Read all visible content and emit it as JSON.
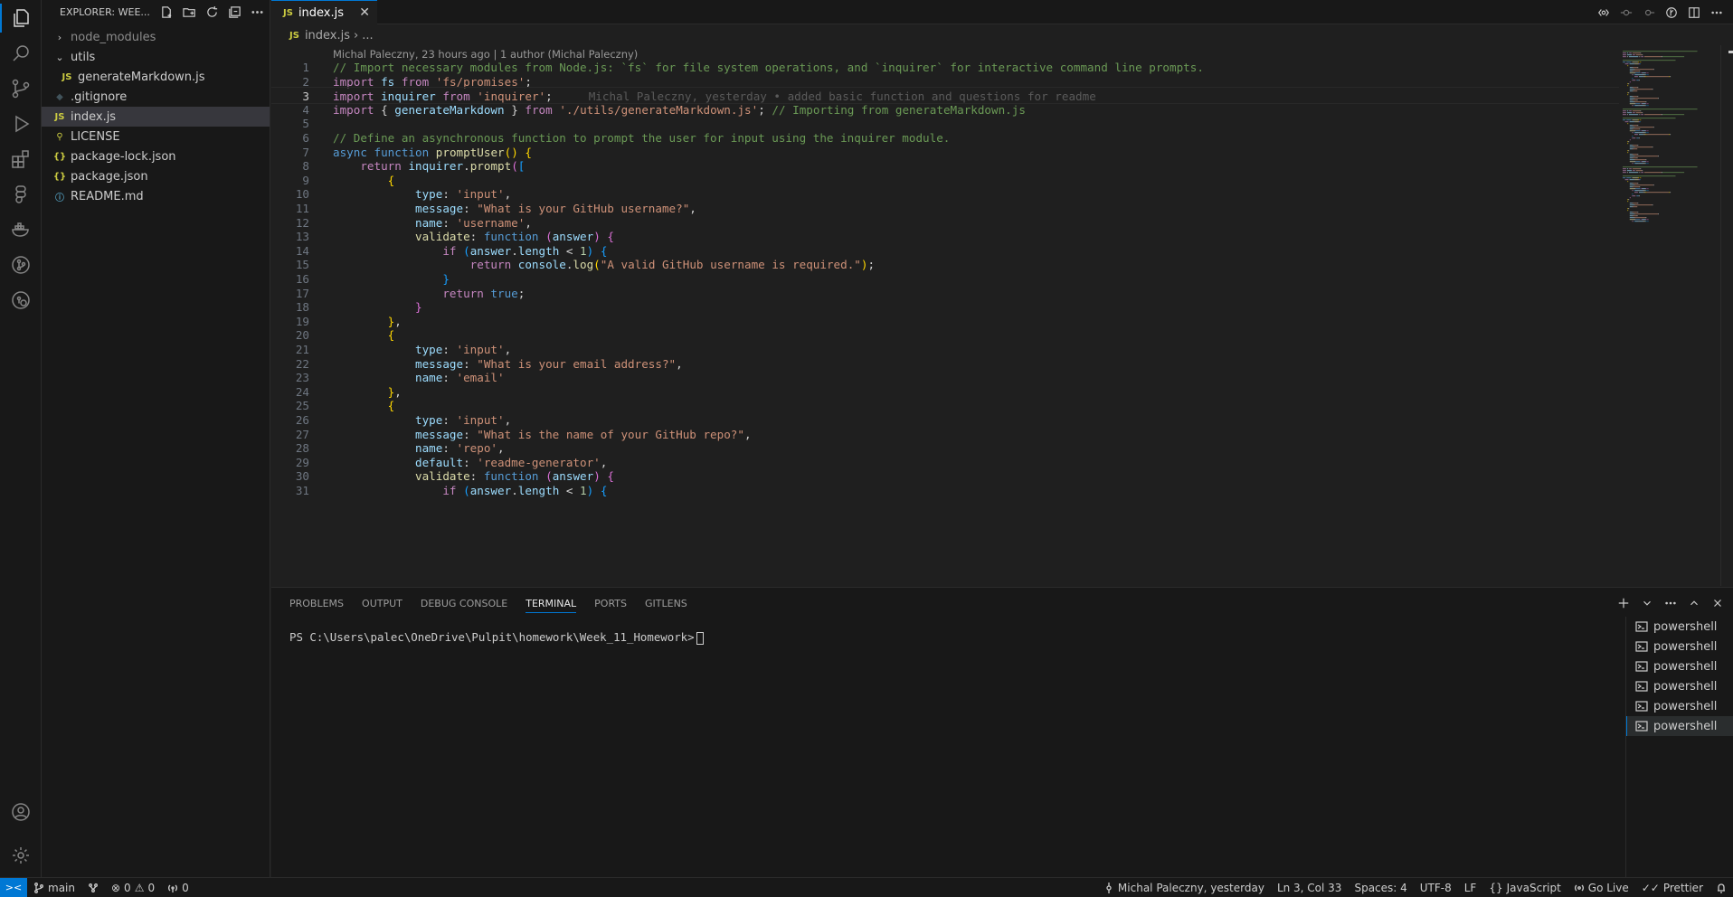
{
  "explorer": {
    "title": "EXPLORER: WEE...",
    "items": [
      {
        "label": "node_modules",
        "type": "folder-collapsed",
        "indent": 0,
        "dim": true
      },
      {
        "label": "utils",
        "type": "folder-expanded",
        "indent": 0
      },
      {
        "label": "generateMarkdown.js",
        "type": "js",
        "indent": 1
      },
      {
        "label": ".gitignore",
        "type": "gitignore",
        "indent": 0
      },
      {
        "label": "index.js",
        "type": "js",
        "indent": 0,
        "selected": true
      },
      {
        "label": "LICENSE",
        "type": "license",
        "indent": 0
      },
      {
        "label": "package-lock.json",
        "type": "json",
        "indent": 0
      },
      {
        "label": "package.json",
        "type": "json",
        "indent": 0
      },
      {
        "label": "README.md",
        "type": "info",
        "indent": 0
      }
    ]
  },
  "tab": {
    "badge": "JS",
    "label": "index.js",
    "close": "✕"
  },
  "breadcrumb": {
    "badge": "JS",
    "file": "index.js",
    "sep": "›",
    "rest": "..."
  },
  "codelens": "Michal Paleczny, 23 hours ago | 1 author (Michal Paleczny)",
  "code": {
    "current_line": 3,
    "blame": "Michal Paleczny, yesterday • added basic function and questions for readme",
    "lines": [
      [
        [
          "// Import necessary modules from Node.js: `fs` for file system operations, and `inquirer` for interactive command line prompts.",
          "com"
        ]
      ],
      [
        [
          "import",
          "kw"
        ],
        [
          " ",
          "txt"
        ],
        [
          "fs",
          "var"
        ],
        [
          " ",
          "txt"
        ],
        [
          "from",
          "kw"
        ],
        [
          " ",
          "txt"
        ],
        [
          "'fs/promises'",
          "str"
        ],
        [
          ";",
          "txt"
        ]
      ],
      [
        [
          "import",
          "kw"
        ],
        [
          " ",
          "txt"
        ],
        [
          "inquirer",
          "var"
        ],
        [
          " ",
          "txt"
        ],
        [
          "from",
          "kw"
        ],
        [
          " ",
          "txt"
        ],
        [
          "'inquirer'",
          "str"
        ],
        [
          ";",
          "txt"
        ]
      ],
      [
        [
          "import",
          "kw"
        ],
        [
          " ",
          "txt"
        ],
        [
          "{",
          "txt"
        ],
        [
          " ",
          "txt"
        ],
        [
          "generateMarkdown",
          "var"
        ],
        [
          " ",
          "txt"
        ],
        [
          "}",
          "txt"
        ],
        [
          " ",
          "txt"
        ],
        [
          "from",
          "kw"
        ],
        [
          " ",
          "txt"
        ],
        [
          "'./utils/generateMarkdown.js'",
          "str"
        ],
        [
          "; ",
          "txt"
        ],
        [
          "// Importing from generateMarkdown.js",
          "com"
        ]
      ],
      [],
      [
        [
          "// Define an asynchronous function to prompt the user for input using the inquirer module.",
          "com"
        ]
      ],
      [
        [
          "async",
          "st"
        ],
        [
          " ",
          "txt"
        ],
        [
          "function",
          "st"
        ],
        [
          " ",
          "txt"
        ],
        [
          "promptUser",
          "fn"
        ],
        [
          "()",
          "br1"
        ],
        [
          " ",
          "txt"
        ],
        [
          "{",
          "br1"
        ]
      ],
      [
        [
          "    ",
          "txt"
        ],
        [
          "return",
          "kw"
        ],
        [
          " ",
          "txt"
        ],
        [
          "inquirer",
          "var"
        ],
        [
          ".",
          "txt"
        ],
        [
          "prompt",
          "fn"
        ],
        [
          "(",
          "br2"
        ],
        [
          "[",
          "br3"
        ]
      ],
      [
        [
          "        ",
          "txt"
        ],
        [
          "{",
          "br1"
        ]
      ],
      [
        [
          "            ",
          "txt"
        ],
        [
          "type",
          "var"
        ],
        [
          ": ",
          "txt"
        ],
        [
          "'input'",
          "str"
        ],
        [
          ",",
          "txt"
        ]
      ],
      [
        [
          "            ",
          "txt"
        ],
        [
          "message",
          "var"
        ],
        [
          ": ",
          "txt"
        ],
        [
          "\"What is your GitHub username?\"",
          "str"
        ],
        [
          ",",
          "txt"
        ]
      ],
      [
        [
          "            ",
          "txt"
        ],
        [
          "name",
          "var"
        ],
        [
          ": ",
          "txt"
        ],
        [
          "'username'",
          "str"
        ],
        [
          ",",
          "txt"
        ]
      ],
      [
        [
          "            ",
          "txt"
        ],
        [
          "validate",
          "fn"
        ],
        [
          ": ",
          "txt"
        ],
        [
          "function",
          "st"
        ],
        [
          " ",
          "txt"
        ],
        [
          "(",
          "br2"
        ],
        [
          "answer",
          "var"
        ],
        [
          ")",
          "br2"
        ],
        [
          " ",
          "txt"
        ],
        [
          "{",
          "br2"
        ]
      ],
      [
        [
          "                ",
          "txt"
        ],
        [
          "if",
          "kw"
        ],
        [
          " ",
          "txt"
        ],
        [
          "(",
          "br3"
        ],
        [
          "answer",
          "var"
        ],
        [
          ".",
          "txt"
        ],
        [
          "length",
          "var"
        ],
        [
          " < ",
          "txt"
        ],
        [
          "1",
          "num"
        ],
        [
          ")",
          "br3"
        ],
        [
          " ",
          "txt"
        ],
        [
          "{",
          "br3"
        ]
      ],
      [
        [
          "                    ",
          "txt"
        ],
        [
          "return",
          "kw"
        ],
        [
          " ",
          "txt"
        ],
        [
          "console",
          "var"
        ],
        [
          ".",
          "txt"
        ],
        [
          "log",
          "fn"
        ],
        [
          "(",
          "br1"
        ],
        [
          "\"A valid GitHub username is required.\"",
          "str"
        ],
        [
          ")",
          "br1"
        ],
        [
          ";",
          "txt"
        ]
      ],
      [
        [
          "                ",
          "txt"
        ],
        [
          "}",
          "br3"
        ]
      ],
      [
        [
          "                ",
          "txt"
        ],
        [
          "return",
          "kw"
        ],
        [
          " ",
          "txt"
        ],
        [
          "true",
          "st"
        ],
        [
          ";",
          "txt"
        ]
      ],
      [
        [
          "            ",
          "txt"
        ],
        [
          "}",
          "br2"
        ]
      ],
      [
        [
          "        ",
          "txt"
        ],
        [
          "}",
          "br1"
        ],
        [
          ",",
          "txt"
        ]
      ],
      [
        [
          "        ",
          "txt"
        ],
        [
          "{",
          "br1"
        ]
      ],
      [
        [
          "            ",
          "txt"
        ],
        [
          "type",
          "var"
        ],
        [
          ": ",
          "txt"
        ],
        [
          "'input'",
          "str"
        ],
        [
          ",",
          "txt"
        ]
      ],
      [
        [
          "            ",
          "txt"
        ],
        [
          "message",
          "var"
        ],
        [
          ": ",
          "txt"
        ],
        [
          "\"What is your email address?\"",
          "str"
        ],
        [
          ",",
          "txt"
        ]
      ],
      [
        [
          "            ",
          "txt"
        ],
        [
          "name",
          "var"
        ],
        [
          ": ",
          "txt"
        ],
        [
          "'email'",
          "str"
        ]
      ],
      [
        [
          "        ",
          "txt"
        ],
        [
          "}",
          "br1"
        ],
        [
          ",",
          "txt"
        ]
      ],
      [
        [
          "        ",
          "txt"
        ],
        [
          "{",
          "br1"
        ]
      ],
      [
        [
          "            ",
          "txt"
        ],
        [
          "type",
          "var"
        ],
        [
          ": ",
          "txt"
        ],
        [
          "'input'",
          "str"
        ],
        [
          ",",
          "txt"
        ]
      ],
      [
        [
          "            ",
          "txt"
        ],
        [
          "message",
          "var"
        ],
        [
          ": ",
          "txt"
        ],
        [
          "\"What is the name of your GitHub repo?\"",
          "str"
        ],
        [
          ",",
          "txt"
        ]
      ],
      [
        [
          "            ",
          "txt"
        ],
        [
          "name",
          "var"
        ],
        [
          ": ",
          "txt"
        ],
        [
          "'repo'",
          "str"
        ],
        [
          ",",
          "txt"
        ]
      ],
      [
        [
          "            ",
          "txt"
        ],
        [
          "default",
          "var"
        ],
        [
          ": ",
          "txt"
        ],
        [
          "'readme-generator'",
          "str"
        ],
        [
          ",",
          "txt"
        ]
      ],
      [
        [
          "            ",
          "txt"
        ],
        [
          "validate",
          "fn"
        ],
        [
          ": ",
          "txt"
        ],
        [
          "function",
          "st"
        ],
        [
          " ",
          "txt"
        ],
        [
          "(",
          "br2"
        ],
        [
          "answer",
          "var"
        ],
        [
          ")",
          "br2"
        ],
        [
          " ",
          "txt"
        ],
        [
          "{",
          "br2"
        ]
      ],
      [
        [
          "                ",
          "txt"
        ],
        [
          "if",
          "kw"
        ],
        [
          " ",
          "txt"
        ],
        [
          "(",
          "br3"
        ],
        [
          "answer",
          "var"
        ],
        [
          ".",
          "txt"
        ],
        [
          "length",
          "var"
        ],
        [
          " < ",
          "txt"
        ],
        [
          "1",
          "num"
        ],
        [
          ")",
          "br3"
        ],
        [
          " ",
          "txt"
        ],
        [
          "{",
          "br3"
        ]
      ]
    ]
  },
  "panel": {
    "tabs": [
      "PROBLEMS",
      "OUTPUT",
      "DEBUG CONSOLE",
      "TERMINAL",
      "PORTS",
      "GITLENS"
    ],
    "active_tab": "TERMINAL",
    "prompt": "PS C:\\Users\\palec\\OneDrive\\Pulpit\\homework\\Week_11_Homework>",
    "terminals": [
      "powershell",
      "powershell",
      "powershell",
      "powershell",
      "powershell",
      "powershell"
    ],
    "active_terminal": 5
  },
  "statusbar": {
    "branch": "main",
    "errors": "0",
    "warnings": "0",
    "ports": "0",
    "blame": "Michal Paleczny, yesterday",
    "position": "Ln 3, Col 33",
    "spaces": "Spaces: 4",
    "encoding": "UTF-8",
    "eol": "LF",
    "language": "JavaScript",
    "golive": "Go Live",
    "prettier": "Prettier"
  },
  "colors": {
    "accent": "#0078d4",
    "background": "#1f1f1f",
    "sidebar": "#181818"
  }
}
